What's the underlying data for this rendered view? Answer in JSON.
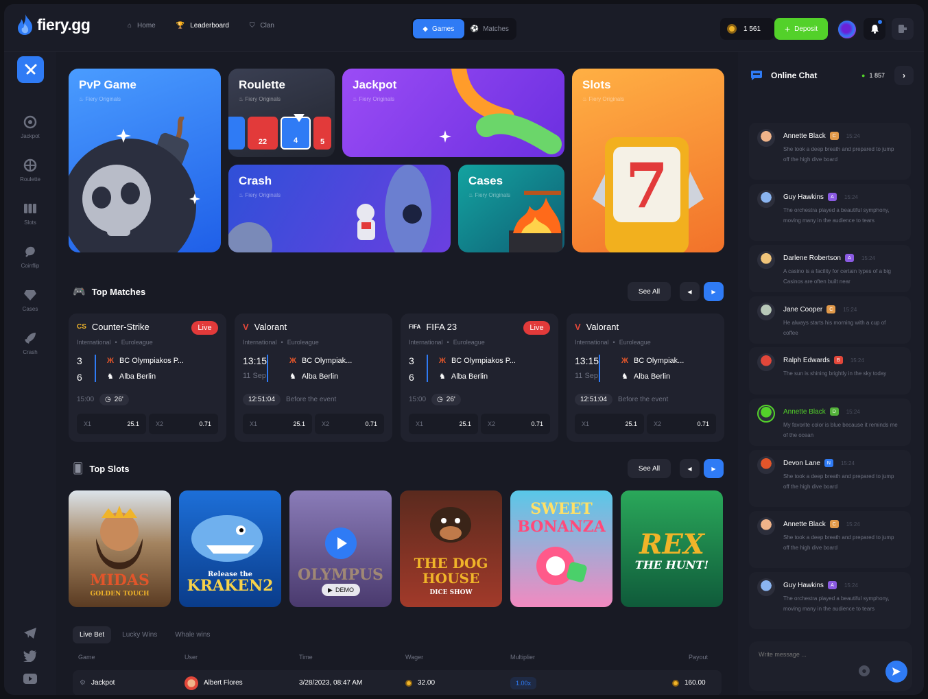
{
  "brand": {
    "name": "fiery.gg"
  },
  "nav": {
    "home": "Home",
    "leaderboard": "Leaderboard",
    "clan": "Clan"
  },
  "toggle": {
    "games": "Games",
    "matches": "Matches"
  },
  "wallet": {
    "balance": "1 561",
    "deposit": "Deposit"
  },
  "sidebar": {
    "items": [
      "Jackpot",
      "Roulette",
      "Slots",
      "Coinflip",
      "Cases",
      "Crash"
    ]
  },
  "games": {
    "subtitle": "Fiery Originals",
    "pvp": "PvP Game",
    "roulette": "Roulette",
    "jackpot": "Jackpot",
    "slots": "Slots",
    "crash": "Crash",
    "cases": "Cases",
    "roulette_numbers": [
      "22",
      "4",
      "5"
    ]
  },
  "top_matches": {
    "title": "Top Matches",
    "see_all": "See All",
    "live": "Live",
    "international": "International",
    "league": "Euroleague",
    "team1": "BC Olympiakos P...",
    "team1_short": "BC Olympiak...",
    "team2": "Alba Berlin",
    "match1": {
      "game": "Counter-Strike",
      "s1": "3",
      "s2": "6",
      "time": "15:00",
      "min": "26'"
    },
    "match2": {
      "game": "Valorant",
      "s1": "13:15",
      "s2": "11 Sep",
      "countdown": "12:51:04",
      "before": "Before the event"
    },
    "match3": {
      "game": "FIFA 23",
      "logo": "FIFA",
      "s1": "3",
      "s2": "6",
      "time": "15:00",
      "min": "26'"
    },
    "match4": {
      "game": "Valorant",
      "s1": "13:15",
      "s2": "11 Sep",
      "countdown": "12:51:04",
      "before": "Before the event"
    },
    "odds": {
      "x1": "X1",
      "x1v": "25.1",
      "x2": "X2",
      "x2v": "0.71"
    }
  },
  "top_slots": {
    "title": "Top Slots",
    "see_all": "See All",
    "demo": "DEMO",
    "items": [
      "MIDAS",
      "GOLDEN TOUCH",
      "Release the",
      "KRAKEN2",
      "OLYMPUS",
      "THE DOG",
      "HOUSE",
      "DICE SHOW",
      "SWEET",
      "BONANZA",
      "REX",
      "THE HUNT!"
    ]
  },
  "live_bets": {
    "tabs": [
      "Live Bet",
      "Lucky Wins",
      "Whale wins"
    ],
    "columns": [
      "Game",
      "User",
      "Time",
      "Wager",
      "Multiplier",
      "Payout"
    ],
    "row": {
      "game": "Jackpot",
      "user": "Albert Flores",
      "time": "3/28/2023, 08:47 AM",
      "wager": "32.00",
      "multiplier": "1.00x",
      "payout": "160.00"
    }
  },
  "chat": {
    "title": "Online Chat",
    "online": "1 857",
    "placeholder": "Write message ...",
    "messages": [
      {
        "name": "Annette Black",
        "badge": "C",
        "time": "15:24",
        "text": "She took a deep breath and prepared to jump off the high dive board"
      },
      {
        "name": "Guy Hawkins",
        "badge": "A",
        "time": "15:24",
        "text": "The orchestra played a beautiful symphony, moving many in the audience to tears"
      },
      {
        "name": "Darlene Robertson",
        "badge": "A",
        "time": "15:24",
        "text": "A casino is a facility for certain types of a big Casinos are often built near"
      },
      {
        "name": "Jane Cooper",
        "badge": "C",
        "time": "15:24",
        "text": "He always starts his morning with a cup of coffee"
      },
      {
        "name": "Ralph Edwards",
        "badge": "B",
        "time": "15:24",
        "text": "The sun is shining brightly in the sky today"
      },
      {
        "name": "Annette Black",
        "badge": "D",
        "time": "15:24",
        "text": "My favorite color is blue because it reminds me of the ocean"
      },
      {
        "name": "Devon Lane",
        "badge": "N",
        "time": "15:24",
        "text": "She took a deep breath and prepared to jump off the high dive board"
      },
      {
        "name": "Annette Black",
        "badge": "C",
        "time": "15:24",
        "text": "She took a deep breath and prepared to jump off the high dive board"
      },
      {
        "name": "Guy Hawkins",
        "badge": "A",
        "time": "15:24",
        "text": "The orchestra played a beautiful symphony, moving many in the audience to tears"
      }
    ]
  },
  "colors": {
    "accent": "#2f7bf5",
    "deposit": "#53d12a",
    "live": "#e23a3a",
    "coin": "#f0b429"
  }
}
